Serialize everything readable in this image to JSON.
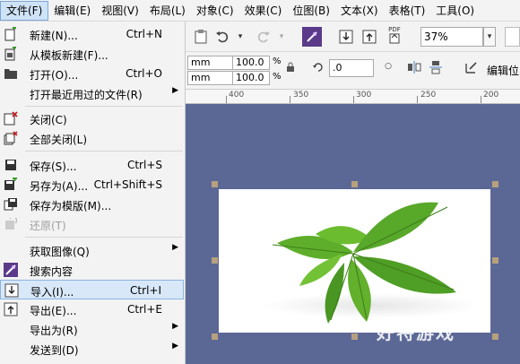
{
  "menubar": {
    "items": [
      "文件(F)",
      "编辑(E)",
      "视图(V)",
      "布局(L)",
      "对象(C)",
      "效果(C)",
      "位图(B)",
      "文本(X)",
      "表格(T)",
      "工具(O)"
    ]
  },
  "toolbar": {
    "pdf_label": "PDF",
    "zoom_value": "37%"
  },
  "propbar": {
    "x_unit": "mm",
    "y_unit": "mm",
    "scale_x": "100.0",
    "scale_y": "100.0",
    "pct1": "%",
    "pct2": "%",
    "rotation": ".0",
    "edit_label": "编辑位"
  },
  "ruler": {
    "labels": [
      "400",
      "350",
      "300",
      "250",
      "200"
    ]
  },
  "file_menu": {
    "items": [
      {
        "label": "新建(N)...",
        "shortcut": "Ctrl+N",
        "icon": "new-document-icon"
      },
      {
        "label": "从模板新建(F)...",
        "shortcut": "",
        "icon": "new-from-template-icon"
      },
      {
        "label": "打开(O)...",
        "shortcut": "Ctrl+O",
        "icon": "open-folder-icon"
      },
      {
        "label": "打开最近用过的文件(R)",
        "shortcut": "",
        "icon": "",
        "submenu": true
      },
      {
        "label": "关闭(C)",
        "shortcut": "",
        "icon": "close-document-icon"
      },
      {
        "label": "全部关闭(L)",
        "shortcut": "",
        "icon": "close-all-icon"
      },
      {
        "label": "保存(S)...",
        "shortcut": "Ctrl+S",
        "icon": "save-icon"
      },
      {
        "label": "另存为(A)...",
        "shortcut": "Ctrl+Shift+S",
        "icon": "save-as-icon"
      },
      {
        "label": "保存为模版(M)...",
        "shortcut": "",
        "icon": "save-template-icon"
      },
      {
        "label": "还原(T)",
        "shortcut": "",
        "icon": "revert-icon",
        "disabled": true
      },
      {
        "label": "获取图像(Q)",
        "shortcut": "",
        "icon": "",
        "submenu": true
      },
      {
        "label": "搜索内容",
        "shortcut": "",
        "icon": "search-content-icon"
      },
      {
        "label": "导入(I)...",
        "shortcut": "Ctrl+I",
        "icon": "import-icon",
        "highlighted": true
      },
      {
        "label": "导出(E)...",
        "shortcut": "Ctrl+E",
        "icon": "export-icon"
      },
      {
        "label": "导出为(R)",
        "shortcut": "",
        "icon": "",
        "submenu": true
      },
      {
        "label": "发送到(D)",
        "shortcut": "",
        "icon": "",
        "submenu": true
      }
    ]
  },
  "watermark": "好特游戏"
}
